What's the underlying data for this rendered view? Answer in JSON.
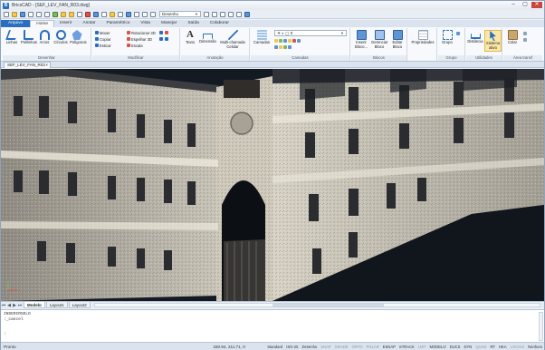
{
  "window": {
    "app_logo": "B",
    "title": "BricsCAD - [SEF_LEV_FAN_R03.dwg]",
    "controls": [
      "–",
      "▢",
      "✕"
    ]
  },
  "quick_access": {
    "workspace": "Desenho",
    "icons": [
      "new-icon",
      "open-icon",
      "save-icon",
      "print-icon",
      "undo-icon",
      "redo-icon",
      "layer-icon",
      "sun-icon",
      "light-icon",
      "grid-icon"
    ]
  },
  "ribbon_tabs": [
    {
      "label": "Arquivo",
      "style": "file"
    },
    {
      "label": "Home",
      "style": "active"
    },
    {
      "label": "Inserir",
      "style": ""
    },
    {
      "label": "Anotar",
      "style": ""
    },
    {
      "label": "Paramétrico",
      "style": ""
    },
    {
      "label": "Vista",
      "style": ""
    },
    {
      "label": "Manejar",
      "style": ""
    },
    {
      "label": "Saída",
      "style": ""
    },
    {
      "label": "Colaborar",
      "style": ""
    }
  ],
  "panels": {
    "desenhar": {
      "title": "Desenhar",
      "buttons": [
        "Linhas",
        "Polilinhas",
        "Arcos",
        "Círculos",
        "Polígonos"
      ]
    },
    "modificar": {
      "title": "Modificar",
      "items": [
        "Mover",
        "Copiar",
        "Esticar",
        "Rotacionar 3D",
        "Espelhar 3D",
        "Escala"
      ]
    },
    "anotacao": {
      "title": "Anotação",
      "buttons": [
        "Texto",
        "Dimensão",
        "Multi-chamada Celular"
      ]
    },
    "camadas": {
      "title": "Camadas",
      "buttons": [
        "Camadas"
      ]
    },
    "blocos": {
      "title": "Blocos",
      "buttons": [
        "Inserir Bloco...",
        "Gerenciar Bloco",
        "Editar Bloco"
      ]
    },
    "propriedades": {
      "buttons": [
        "Propriedades"
      ]
    },
    "grupo": {
      "title": "Grupo",
      "buttons": [
        "Grupo"
      ]
    },
    "utilidades": {
      "title": "Utilidades",
      "buttons": [
        "Distância",
        "Sistema ativo"
      ]
    },
    "area_transf": {
      "title": "Área transf",
      "buttons": [
        "Colar"
      ]
    }
  },
  "document_tab": {
    "label": "SEF_LEV_FAN_R03",
    "close": "×"
  },
  "layout_tabs": [
    "Modelo",
    "Layout1",
    "Layout2"
  ],
  "command_line": {
    "history": [
      "INSERIRSELO",
      "",
      ":_cancel"
    ],
    "prompt": ":"
  },
  "status_bar": {
    "left": "Pronto",
    "coordinates": "330.94, 211.71, 0",
    "items": [
      {
        "label": "Standard",
        "on": true
      },
      {
        "label": "ISO-25",
        "on": true
      },
      {
        "label": "Desenho",
        "on": true
      },
      {
        "label": "SNAP",
        "on": false
      },
      {
        "label": "GRADE",
        "on": false
      },
      {
        "label": "ORTO",
        "on": false
      },
      {
        "label": "POLAR",
        "on": false
      },
      {
        "label": "ESNAP",
        "on": true
      },
      {
        "label": "STRACK",
        "on": true
      },
      {
        "label": "LWT",
        "on": false
      },
      {
        "label": "MODELO",
        "on": true
      },
      {
        "label": "DUCS",
        "on": true
      },
      {
        "label": "DYN",
        "on": true
      },
      {
        "label": "QUAD",
        "on": false
      },
      {
        "label": "RT",
        "on": true
      },
      {
        "label": "HKA",
        "on": true
      },
      {
        "label": "LOCKUI",
        "on": false
      },
      {
        "label": "Nenhum",
        "on": true
      }
    ]
  },
  "colors": {
    "accent": "#2a6fbf",
    "viewport_bg": "#141a22",
    "close_button": "#c9463d"
  }
}
